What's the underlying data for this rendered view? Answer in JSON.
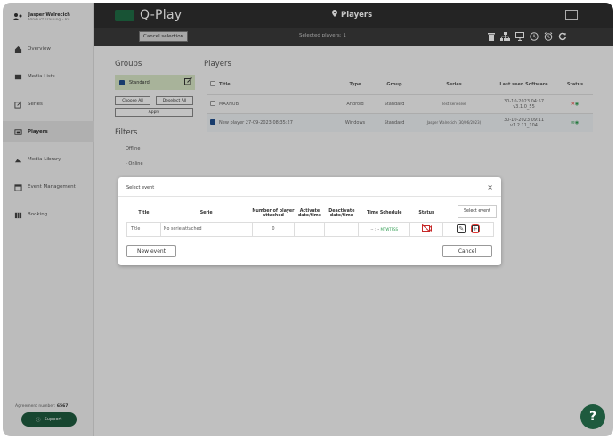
{
  "user": {
    "name": "Jasper Walrecich",
    "role": "Product Training - Ru..."
  },
  "sidebar": {
    "items": [
      {
        "label": "Overview",
        "icon": "home-icon"
      },
      {
        "label": "Media Lists",
        "icon": "list-icon"
      },
      {
        "label": "Series",
        "icon": "edit-icon"
      },
      {
        "label": "Players",
        "icon": "player-icon",
        "active": true
      },
      {
        "label": "Media Library",
        "icon": "image-icon"
      },
      {
        "label": "Event Management",
        "icon": "calendar-icon"
      },
      {
        "label": "Booking",
        "icon": "grid-icon"
      }
    ],
    "agreement_label": "Agreement number:",
    "agreement_number": "6567",
    "support_label": "Support"
  },
  "header": {
    "app_name": "Q-Play",
    "page_title": "Players"
  },
  "selection_bar": {
    "cancel_label": "Cancel selection",
    "selected_text": "Selected players: 1"
  },
  "groups": {
    "title": "Groups",
    "items": [
      {
        "label": "Standard",
        "checked": true
      }
    ],
    "choose_all": "Choose All",
    "deselect_all": "Deselect All",
    "apply": "Apply"
  },
  "filters": {
    "title": "Filters",
    "items": [
      "Offline",
      "- Online"
    ]
  },
  "players": {
    "title": "Players",
    "columns": [
      "Title",
      "Type",
      "Group",
      "Series",
      "Last seen Software",
      "Status"
    ],
    "rows": [
      {
        "title": "MAXHUB",
        "type": "Android",
        "group": "Standard",
        "series": "Test serieseie",
        "last_seen": "30-10-2023 04:57",
        "software": "v3.1.0_55",
        "checked": false
      },
      {
        "title": "New player 27-09-2023 08:35:27",
        "type": "Windows",
        "group": "Standard",
        "series": "Jasper Walrecich (30/06/2023)",
        "last_seen": "30-10-2023 09:11",
        "software": "v1.2.11_104",
        "checked": true
      }
    ]
  },
  "modal": {
    "title": "Select event",
    "close": "×",
    "columns": [
      "Title",
      "Serie",
      "Number of player attached",
      "Activate date/time",
      "Deactivate date/time",
      "Time Schedule",
      "Status"
    ],
    "select_event_label": "Select event",
    "row": {
      "title": "Title",
      "serie": "No serie attached",
      "players": "0",
      "activate": "",
      "deactivate": "",
      "schedule_time": "-- : --",
      "schedule_days": "MTWTFSS"
    },
    "new_event": "New event",
    "cancel": "Cancel"
  },
  "colors": {
    "brand": "#1e5a3e",
    "header": "#2f2f2f",
    "accent_red": "#e53935"
  },
  "help_label": "?"
}
